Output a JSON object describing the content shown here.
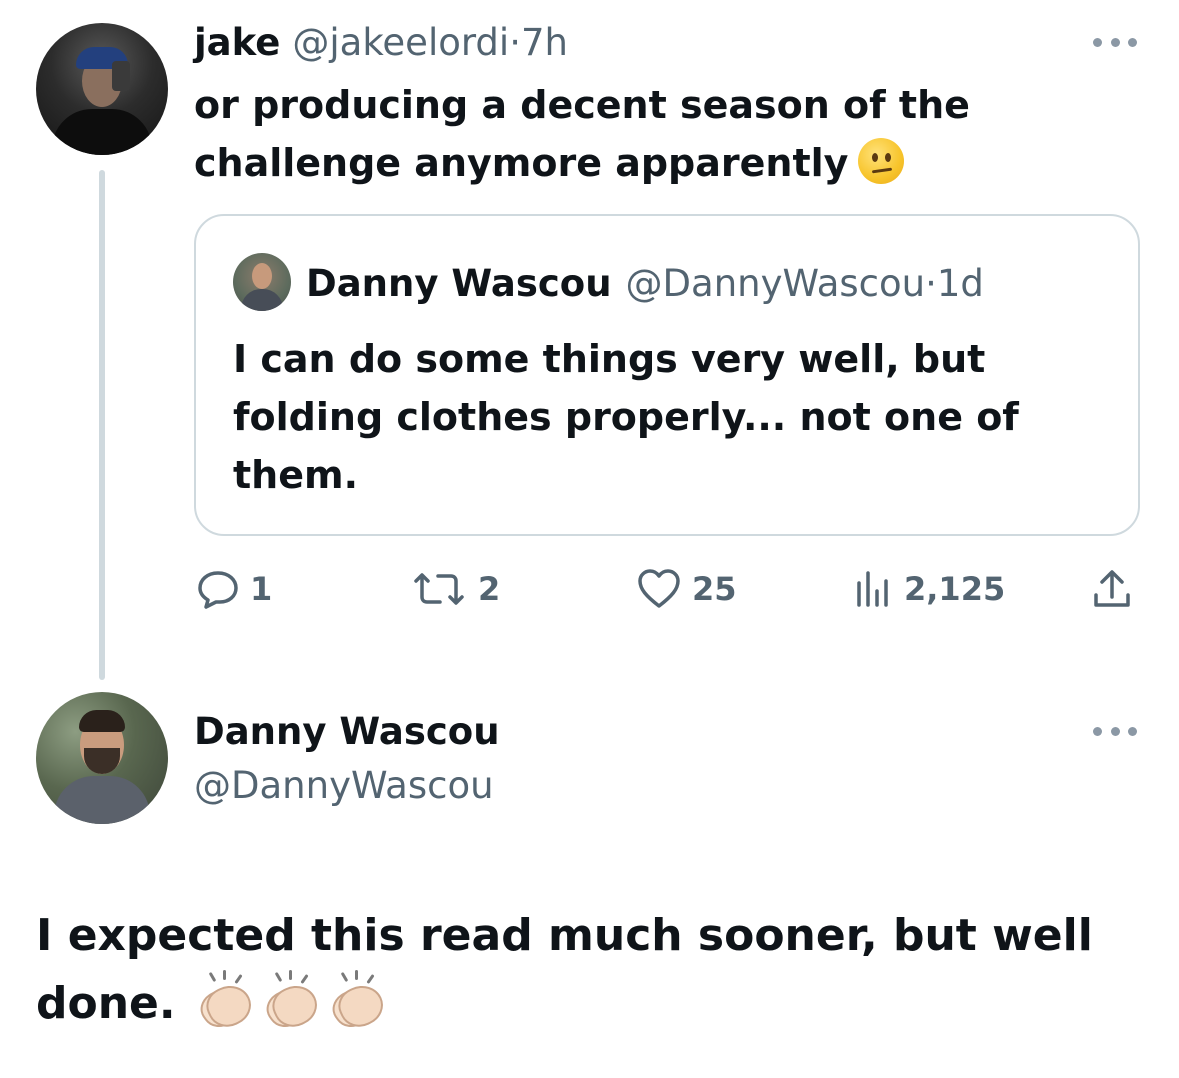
{
  "parent_tweet": {
    "display_name": "jake",
    "handle": "@jakeelordi",
    "separator": "·",
    "time": "7h",
    "text": "or producing a decent season of the challenge anymore apparently",
    "emoji": "neutral-face",
    "quoted": {
      "display_name": "Danny Wascou",
      "handle": "@DannyWascou",
      "separator": "·",
      "time": "1d",
      "text": "I can do some things very well, but folding clothes properly... not one of them."
    },
    "actions": {
      "replies": "1",
      "retweets": "2",
      "likes": "25",
      "views": "2,125"
    }
  },
  "reply_tweet": {
    "display_name": "Danny Wascou",
    "handle": "@DannyWascou",
    "text": "I expected this read much sooner, but well done.",
    "emoji": [
      "clapping-hands",
      "clapping-hands",
      "clapping-hands"
    ]
  },
  "colors": {
    "text_primary": "#0f1419",
    "text_secondary": "#536471",
    "border": "#cfd9de",
    "thread_line": "#cfd9de"
  }
}
